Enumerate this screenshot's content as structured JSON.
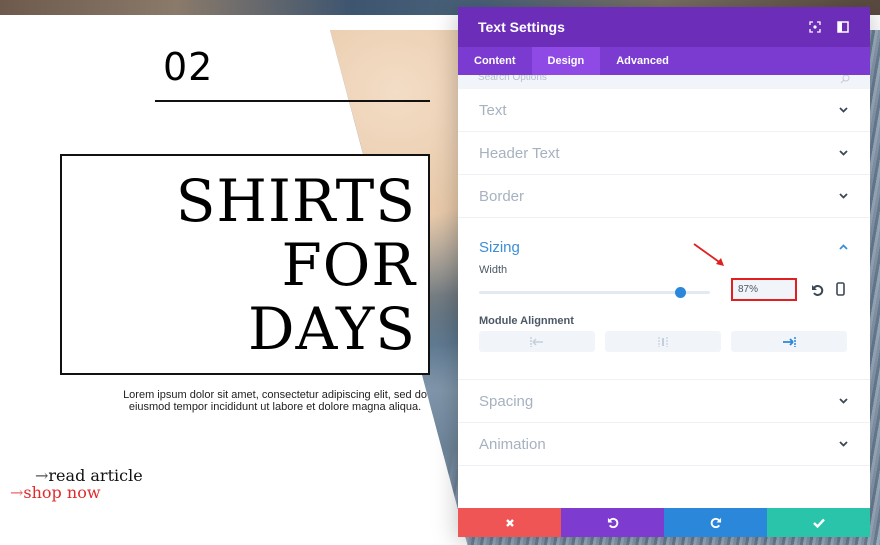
{
  "page": {
    "number": "02",
    "title_lines": [
      "SHIRTS",
      "FOR",
      "DAYS"
    ],
    "body_lines": [
      "Lorem ipsum dolor sit amet, consectetur adipiscing elit, sed do",
      "eiusmod tempor incididunt ut labore et dolore magna aliqua."
    ],
    "links": [
      {
        "arrow": "→",
        "label": "read article"
      },
      {
        "arrow": "→",
        "label": "shop now"
      }
    ]
  },
  "modal": {
    "title": "Text Settings",
    "header_icons": [
      "fullscreen-icon",
      "sidebar-icon"
    ],
    "tabs": [
      {
        "label": "Content",
        "active": false
      },
      {
        "label": "Design",
        "active": true
      },
      {
        "label": "Advanced",
        "active": false
      }
    ],
    "search_placeholder": "Search Options",
    "sections_before": [
      {
        "label": "Text"
      },
      {
        "label": "Header Text"
      },
      {
        "label": "Border"
      }
    ],
    "sizing": {
      "label": "Sizing",
      "expanded": true,
      "width_label": "Width",
      "width_value": "87%",
      "width_percent": 87,
      "alignment_label": "Module Alignment",
      "alignment_options": [
        "left",
        "center",
        "right"
      ],
      "alignment_selected": "right"
    },
    "sections_after": [
      {
        "label": "Spacing"
      },
      {
        "label": "Animation"
      }
    ],
    "footer": [
      {
        "name": "discard",
        "icon": "✖",
        "color": "#ef5555"
      },
      {
        "name": "undo",
        "icon": "↺",
        "color": "#7e3bd0"
      },
      {
        "name": "redo",
        "icon": "↻",
        "color": "#2b87da"
      },
      {
        "name": "save",
        "icon": "✔",
        "color": "#29c4a9"
      }
    ]
  },
  "colors": {
    "header": "#6c2eb9",
    "tabs": "#7b3bd0",
    "active_tab": "#8f4ae6",
    "accent_blue": "#2b87da",
    "highlight_red": "#e02020",
    "link_red": "#e02b2b"
  }
}
